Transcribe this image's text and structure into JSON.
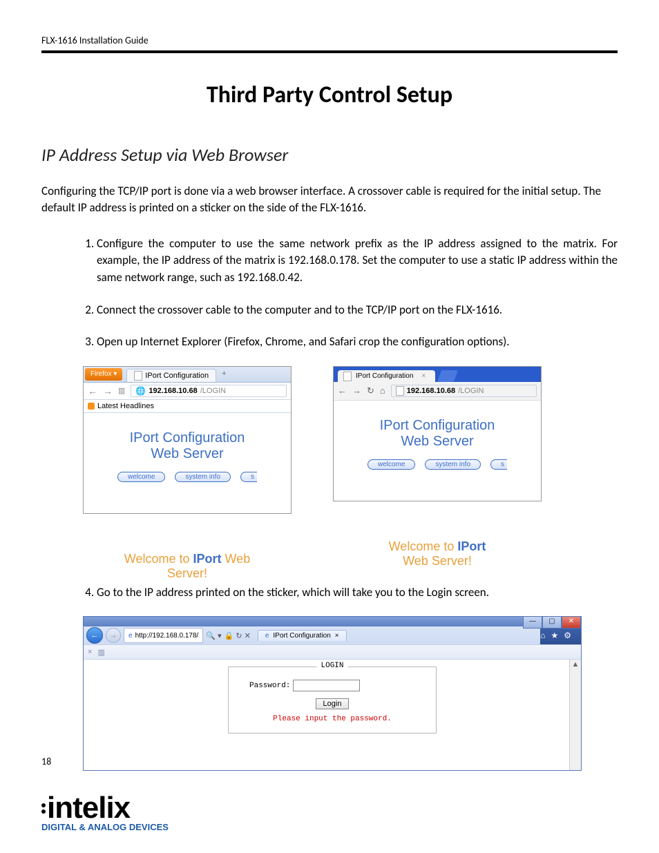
{
  "header": {
    "guide": "FLX-1616 Installation Guide"
  },
  "title": "Third Party Control Setup",
  "subtitle": "IP Address Setup via Web Browser",
  "intro": "Configuring the TCP/IP port is done via a web browser interface. A crossover cable is required for the initial setup. The default IP address is printed on a sticker on the side of the FLX-1616.",
  "steps": {
    "s1": "Configure the computer to use the same network prefix as the IP address assigned to the matrix. For example, the IP address of the matrix is 192.168.0.178. Set the computer to use a static IP address within the same network range, such as 192.168.0.42.",
    "s2": "Connect the crossover cable to the computer and to the TCP/IP port on the FLX-1616.",
    "s3": "Open up Internet Explorer (Firefox, Chrome, and Safari crop the configuration options).",
    "s4": "Go to the IP address printed on the sticker, which will take you to the Login screen."
  },
  "firefox": {
    "btn": "Firefox ▾",
    "tab": "IPort Configuration",
    "plus": "+",
    "url_bold": "192.168.10.68",
    "url_path": "/LOGIN",
    "bookmark": "Latest Headlines"
  },
  "chrome": {
    "tab": "IPort Configuration",
    "url_bold": "192.168.10.68",
    "url_path": "/LOGIN"
  },
  "iport": {
    "line1": "IPort Configuration",
    "line2": "Web Server",
    "pill1": "welcome",
    "pill2": "system info",
    "pill3": "s"
  },
  "welcome": {
    "p1": "Welcome to ",
    "p2": "IPort",
    "p3": " Web",
    "p4": "Server!",
    "c_p1": "Welcome to ",
    "c_p2": "IPort",
    "c_p3": "Web Server!"
  },
  "ie": {
    "url_full": "http://192.168.0.178/",
    "search_hint": "▾",
    "toolbar_icons": "🔒 ↻ ✕",
    "tab": "IPort Configuration",
    "close": "×"
  },
  "login": {
    "legend": "LOGIN",
    "pw_label": "Password:",
    "btn": "Login",
    "error": "Please input the password."
  },
  "footer": {
    "page": "18",
    "logo": "intelix",
    "tag": "DIGITAL & ANALOG DEVICES"
  }
}
